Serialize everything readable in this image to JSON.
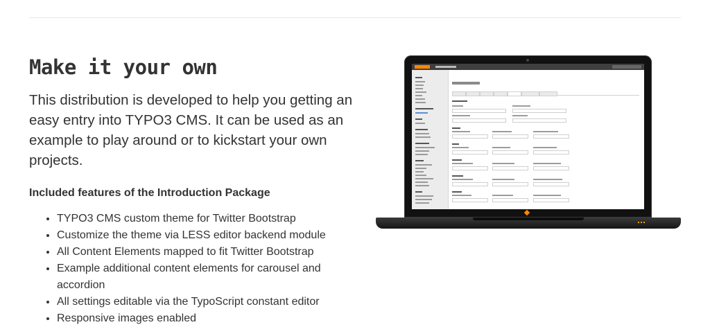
{
  "intro": {
    "heading": "Make it your own",
    "lead": "This distribution is developed to help you getting an easy entry into TYPO3 CMS. It can be used as an example to play around or to kickstart your own projects."
  },
  "features": {
    "title": "Included features of the Introduction Package",
    "items": [
      "TYPO3 CMS custom theme for Twitter Bootstrap",
      "Customize the theme via LESS editor backend module",
      "All Content Elements mapped to fit Twitter Bootstrap",
      "Example additional content elements for carousel and accordion",
      "All settings editable via the TypoScript constant editor",
      "Responsive images enabled"
    ]
  },
  "image": {
    "icon": "laptop-screenshot",
    "screen_title": "Style Settings"
  },
  "colors": {
    "text": "#333333",
    "accent": "#ff8700",
    "rule": "#e7e7e7"
  }
}
